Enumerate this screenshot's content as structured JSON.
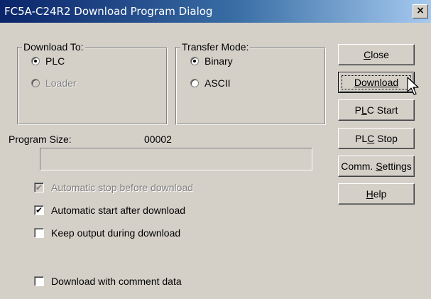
{
  "window": {
    "title": "FC5A-C24R2 Download Program Dialog",
    "close_glyph": "×"
  },
  "download_to": {
    "legend": "Download To:",
    "options": [
      {
        "label": "PLC",
        "selected": true,
        "enabled": true
      },
      {
        "label": "Loader",
        "selected": false,
        "enabled": false
      }
    ]
  },
  "transfer_mode": {
    "legend": "Transfer Mode:",
    "options": [
      {
        "label": "Binary",
        "selected": true,
        "enabled": true
      },
      {
        "label": "ASCII",
        "selected": false,
        "enabled": true
      }
    ]
  },
  "program_size": {
    "label": "Program Size:",
    "value": "00002"
  },
  "checkboxes": [
    {
      "label": "Automatic stop before download",
      "checked": true,
      "enabled": false
    },
    {
      "label": "Automatic start after download",
      "checked": true,
      "enabled": true
    },
    {
      "label": "Keep output during download",
      "checked": false,
      "enabled": true
    },
    {
      "label": "Download with comment data",
      "checked": false,
      "enabled": true
    }
  ],
  "buttons": {
    "close": {
      "mnemonic": "C",
      "rest": "lose"
    },
    "download": {
      "mnemonic": "D",
      "rest": "ownload"
    },
    "plc_start": {
      "pre": "P",
      "mnemonic": "L",
      "rest": "C Start"
    },
    "plc_stop": {
      "pre": "PL",
      "mnemonic": "C",
      "rest": " Stop"
    },
    "comm_settings": {
      "pre": "Comm. ",
      "mnemonic": "S",
      "rest": "ettings"
    },
    "help": {
      "mnemonic": "H",
      "rest": "elp"
    }
  },
  "icons": {
    "checkmark": "✔",
    "window_close": "close-icon",
    "pointer": "arrow-cursor"
  }
}
